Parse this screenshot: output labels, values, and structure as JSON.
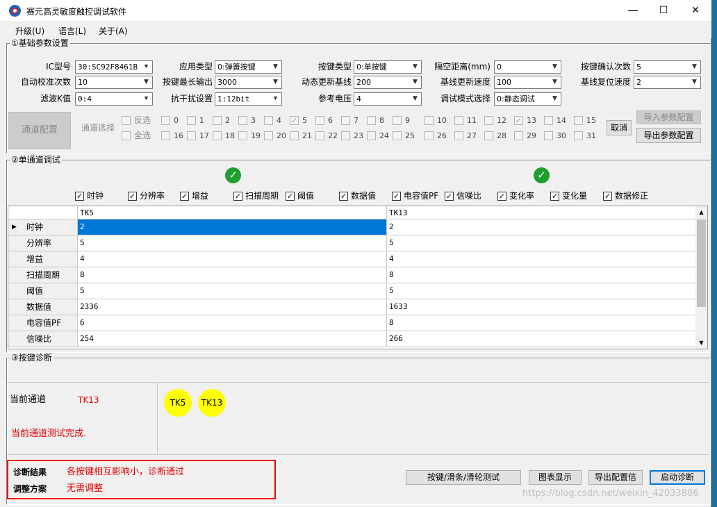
{
  "window": {
    "title": "赛元高灵敏度触控调试软件",
    "minimize": "—",
    "maximize": "☐",
    "close": "✕"
  },
  "menu": [
    "升级(U)",
    "语言(L)",
    "关于(A)"
  ],
  "basic": {
    "title": "①基础参数设置",
    "fields": {
      "ic_type": {
        "label": "IC型号",
        "value": "30:SC92F8461B"
      },
      "app_type": {
        "label": "应用类型",
        "value": "0:弹簧按键"
      },
      "key_type": {
        "label": "按键类型",
        "value": "0:单按键"
      },
      "gap": {
        "label": "隔空距离(mm)",
        "value": "0"
      },
      "confirm_times": {
        "label": "按键确认次数",
        "value": "5"
      },
      "auto_cal": {
        "label": "自动校准次数",
        "value": "10"
      },
      "max_output": {
        "label": "按键最长输出",
        "value": "3000"
      },
      "dyn_baseline": {
        "label": "动态更新基线",
        "value": "200"
      },
      "baseline_speed": {
        "label": "基线更新速度",
        "value": "100"
      },
      "baseline_reset": {
        "label": "基线复位速度",
        "value": "2"
      },
      "filter_k": {
        "label": "滤波K值",
        "value": "0:4"
      },
      "anti_interf": {
        "label": "抗干扰设置",
        "value": "1:12bit"
      },
      "ref_voltage": {
        "label": "参考电压",
        "value": "4"
      },
      "debug_mode": {
        "label": "调试模式选择",
        "value": "0:静态调试"
      }
    },
    "channel_config_button": "通道配置",
    "channel_select_label": "通道选择",
    "invert_label": "反选",
    "select_all_label": "全选",
    "channels": [
      {
        "n": "0",
        "checked": false
      },
      {
        "n": "1",
        "checked": false
      },
      {
        "n": "2",
        "checked": false
      },
      {
        "n": "3",
        "checked": false
      },
      {
        "n": "4",
        "checked": false
      },
      {
        "n": "5",
        "checked": true
      },
      {
        "n": "6",
        "checked": false
      },
      {
        "n": "7",
        "checked": false
      },
      {
        "n": "8",
        "checked": false
      },
      {
        "n": "9",
        "checked": false
      },
      {
        "n": "10",
        "checked": false
      },
      {
        "n": "11",
        "checked": false
      },
      {
        "n": "12",
        "checked": false
      },
      {
        "n": "13",
        "checked": true
      },
      {
        "n": "14",
        "checked": false
      },
      {
        "n": "15",
        "checked": false
      },
      {
        "n": "16",
        "checked": false
      },
      {
        "n": "17",
        "checked": false
      },
      {
        "n": "18",
        "checked": false
      },
      {
        "n": "19",
        "checked": false
      },
      {
        "n": "20",
        "checked": false
      },
      {
        "n": "21",
        "checked": false
      },
      {
        "n": "22",
        "checked": false
      },
      {
        "n": "23",
        "checked": false
      },
      {
        "n": "24",
        "checked": false
      },
      {
        "n": "25",
        "checked": false
      },
      {
        "n": "26",
        "checked": false
      },
      {
        "n": "27",
        "checked": false
      },
      {
        "n": "28",
        "checked": false
      },
      {
        "n": "29",
        "checked": false
      },
      {
        "n": "30",
        "checked": false
      },
      {
        "n": "31",
        "checked": false
      }
    ],
    "cancel_button": "取消",
    "import_button": "导入参数配置",
    "export_button": "导出参数配置"
  },
  "single": {
    "title": "②单通道调试",
    "options": [
      "时钟",
      "分辨率",
      "增益",
      "扫描周期",
      "阈值",
      "数据值",
      "电容值PF",
      "信噪比",
      "变化率",
      "变化量",
      "数据修正"
    ],
    "columns": [
      "TK5",
      "TK13"
    ],
    "rows": [
      {
        "name": "时钟",
        "v": [
          "2",
          "2"
        ]
      },
      {
        "name": "分辨率",
        "v": [
          "5",
          "5"
        ]
      },
      {
        "name": "增益",
        "v": [
          "4",
          "4"
        ]
      },
      {
        "name": "扫描周期",
        "v": [
          "8",
          "8"
        ]
      },
      {
        "name": "阈值",
        "v": [
          "5",
          "5"
        ]
      },
      {
        "name": "数据值",
        "v": [
          "2336",
          "1633"
        ]
      },
      {
        "name": "电容值PF",
        "v": [
          "6",
          "8"
        ]
      },
      {
        "name": "信噪比",
        "v": [
          "254",
          "266"
        ]
      }
    ]
  },
  "diag": {
    "title": "③按键诊断",
    "current_channel_label": "当前通道",
    "current_channel_value": "TK13",
    "status": "当前通道测试完成.",
    "keys": [
      "TK5",
      "TK13"
    ],
    "result_label": "诊断结果",
    "result_value": "各按键相互影响小，诊断通过",
    "adjust_label": "调整方案",
    "adjust_value": "无需调整",
    "buttons": {
      "slider_test": "按键/滑条/滑轮测试",
      "chart": "图表显示",
      "export_cfg": "导出配置信",
      "start": "启动诊断"
    }
  },
  "watermark": "https://blog.csdn.net/weixin_42033886",
  "colors": {
    "selection": "#0078d7",
    "ok_green": "#1e9e2e",
    "key_yellow": "#ffff00",
    "alert_red": "#e00000"
  }
}
